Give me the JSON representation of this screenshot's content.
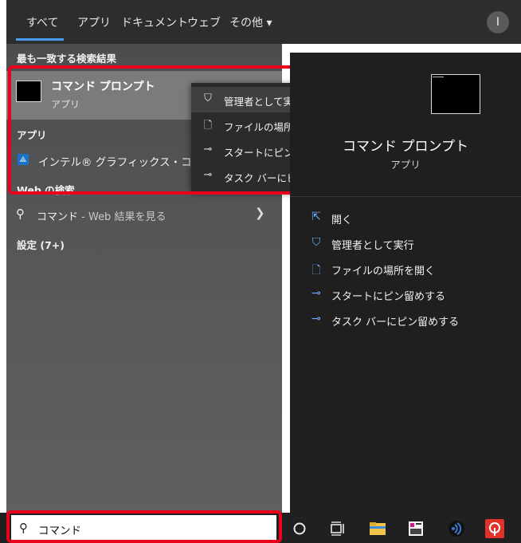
{
  "tabs": [
    "すべて",
    "アプリ",
    "ドキュメント",
    "ウェブ",
    "その他"
  ],
  "tabs_more_chevron": "▾",
  "account_initial": "I",
  "best_match": {
    "section_label": "最も一致する検索結果",
    "title": "コマンド プロンプト",
    "subtitle": "アプリ"
  },
  "apps": {
    "section_label": "アプリ",
    "item_label": "インテル® グラフィックス・コマンド・"
  },
  "web": {
    "section_label": "Web の検索",
    "query": "コマンド",
    "suffix": " - Web 結果を見る"
  },
  "settings_label": "設定 (7+)",
  "context_menu": [
    {
      "label": "管理者として実行",
      "icon": "shield-icon"
    },
    {
      "label": "ファイルの場所を開く",
      "icon": "file-icon"
    },
    {
      "label": "スタートにピン留めする",
      "icon": "pin-icon"
    },
    {
      "label": "タスク バーにピン留めする",
      "icon": "pin-icon"
    }
  ],
  "preview": {
    "title": "コマンド プロンプト",
    "subtitle": "アプリ",
    "actions": [
      {
        "label": "開く",
        "icon": "open-icon"
      },
      {
        "label": "管理者として実行",
        "icon": "shield-icon"
      },
      {
        "label": "ファイルの場所を開く",
        "icon": "file-icon"
      },
      {
        "label": "スタートにピン留めする",
        "icon": "pin-icon"
      },
      {
        "label": "タスク バーにピン留めする",
        "icon": "pin-icon"
      }
    ]
  },
  "search": {
    "value": "コマンド"
  },
  "colors": {
    "highlight": "#e8001c",
    "accent": "#4a9cf0",
    "action_icon": "#6ab0ff"
  }
}
